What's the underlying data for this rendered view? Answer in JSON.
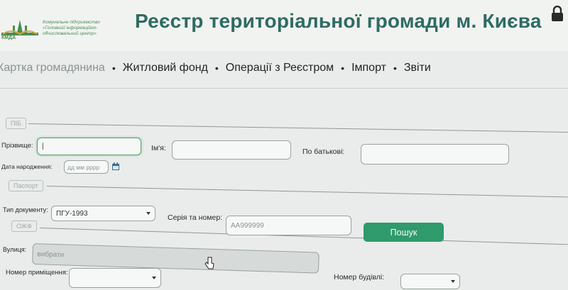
{
  "header": {
    "title": "Реєстр територіальної громади м. Києва",
    "org_line1": "Комунальне підприємство",
    "org_line2": "«Головний інформаційно-",
    "org_line3": "обчислювальний центр»",
    "logo_text": "КМДА"
  },
  "nav": {
    "items": [
      "Картка громадянина",
      "Житловий фонд",
      "Операції з Реєстром",
      "Імпорт",
      "Звіти"
    ],
    "separator": "•"
  },
  "sections": {
    "pib": "ПІБ",
    "passport": "Паспорт",
    "address": "ОЖФ"
  },
  "fields": {
    "surname_label": "Прізвище:",
    "name_label": "Ім'я:",
    "patronymic_label": "По батькові:",
    "birthdate_label": "Дата народження:",
    "birthdate_placeholder": "дд мм рррр",
    "doc_type_label": "Тип документу:",
    "doc_type_value": "ПГУ-1993",
    "series_label": "Серія та номер:",
    "series_placeholder": "АА999999",
    "street_label": "Вулиця:",
    "street_placeholder": "вибрати",
    "room_label": "Номер приміщення:",
    "building_label": "Номер будівлі:"
  },
  "search_button": "Пошук",
  "colors": {
    "accent": "#2f9a6c",
    "title": "#2f6b62",
    "focus": "#54a267"
  },
  "icons": {
    "lock": "lock-icon",
    "calendar": "calendar-icon",
    "cursor": "hand-cursor-icon"
  }
}
